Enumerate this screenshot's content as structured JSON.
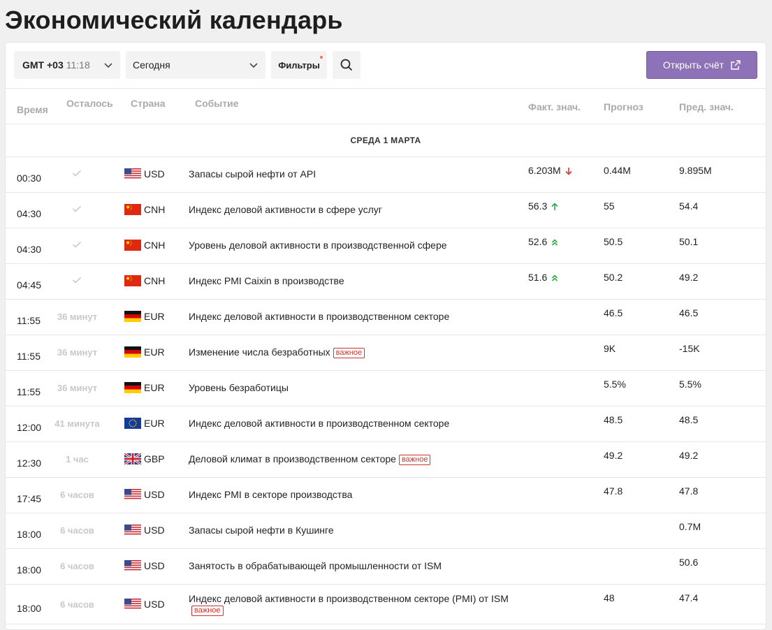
{
  "title": "Экономический календарь",
  "toolbar": {
    "tz_code": "GMT +03",
    "tz_time": "11:18",
    "date_value": "Сегодня",
    "filters_label": "Фильтры",
    "open_account_label": "Открыть счёт"
  },
  "columns": {
    "time": "Время",
    "left": "Осталось",
    "country": "Страна",
    "event": "Событие",
    "actual": "Факт. знач.",
    "forecast": "Прогноз",
    "previous": "Пред. знач."
  },
  "section_date": "СРЕДА 1 МАРТА",
  "colors": {
    "accent": "#8d72b8",
    "down": "#e0352b",
    "up": "#2eaa4a",
    "important": "#d0342c"
  },
  "rows": [
    {
      "time": "00:30",
      "left": "",
      "done": true,
      "flag": "us-flag",
      "currency": "USD",
      "event": "Запасы сырой нефти от API",
      "badge": "",
      "actual": "6.203M",
      "trend": "down",
      "forecast": "0.44M",
      "previous": "9.895M"
    },
    {
      "time": "04:30",
      "left": "",
      "done": true,
      "flag": "cn-flag",
      "currency": "CNH",
      "event": "Индекс деловой активности в сфере услуг",
      "badge": "",
      "actual": "56.3",
      "trend": "up",
      "forecast": "55",
      "previous": "54.4"
    },
    {
      "time": "04:30",
      "left": "",
      "done": true,
      "flag": "cn-flag",
      "currency": "CNH",
      "event": "Уровень деловой активности в производственной сфере",
      "badge": "",
      "actual": "52.6",
      "trend": "up2",
      "forecast": "50.5",
      "previous": "50.1"
    },
    {
      "time": "04:45",
      "left": "",
      "done": true,
      "flag": "cn-flag",
      "currency": "CNH",
      "event": "Индекс PMI Caixin в производстве",
      "badge": "",
      "actual": "51.6",
      "trend": "up2",
      "forecast": "50.2",
      "previous": "49.2"
    },
    {
      "time": "11:55",
      "left": "36 минут",
      "done": false,
      "flag": "de-flag",
      "currency": "EUR",
      "event": "Индекс деловой активности в производственном секторе",
      "badge": "",
      "actual": "",
      "trend": "",
      "forecast": "46.5",
      "previous": "46.5"
    },
    {
      "time": "11:55",
      "left": "36 минут",
      "done": false,
      "flag": "de-flag",
      "currency": "EUR",
      "event": "Изменение числа безработных",
      "badge": "важное",
      "actual": "",
      "trend": "",
      "forecast": "9K",
      "previous": "-15K"
    },
    {
      "time": "11:55",
      "left": "36 минут",
      "done": false,
      "flag": "de-flag",
      "currency": "EUR",
      "event": "Уровень безработицы",
      "badge": "",
      "actual": "",
      "trend": "",
      "forecast": "5.5%",
      "previous": "5.5%"
    },
    {
      "time": "12:00",
      "left": "41 минута",
      "done": false,
      "flag": "eu-flag",
      "currency": "EUR",
      "event": "Индекс деловой активности в производственном секторе",
      "badge": "",
      "actual": "",
      "trend": "",
      "forecast": "48.5",
      "previous": "48.5"
    },
    {
      "time": "12:30",
      "left": "1 час",
      "done": false,
      "flag": "gb-flag",
      "currency": "GBP",
      "event": "Деловой климат в производственном секторе",
      "badge": "важное",
      "actual": "",
      "trend": "",
      "forecast": "49.2",
      "previous": "49.2"
    },
    {
      "time": "17:45",
      "left": "6 часов",
      "done": false,
      "flag": "us-flag",
      "currency": "USD",
      "event": "Индекс PMI в секторе производства",
      "badge": "",
      "actual": "",
      "trend": "",
      "forecast": "47.8",
      "previous": "47.8"
    },
    {
      "time": "18:00",
      "left": "6 часов",
      "done": false,
      "flag": "us-flag",
      "currency": "USD",
      "event": "Запасы сырой нефти в Кушинге",
      "badge": "",
      "actual": "",
      "trend": "",
      "forecast": "",
      "previous": "0.7M"
    },
    {
      "time": "18:00",
      "left": "6 часов",
      "done": false,
      "flag": "us-flag",
      "currency": "USD",
      "event": "Занятость в обрабатывающей промышленности от ISM",
      "badge": "",
      "actual": "",
      "trend": "",
      "forecast": "",
      "previous": "50.6"
    },
    {
      "time": "18:00",
      "left": "6 часов",
      "done": false,
      "flag": "us-flag",
      "currency": "USD",
      "event": "Индекс деловой активности в производственном секторе (PMI) от ISM",
      "badge": "важное",
      "actual": "",
      "trend": "",
      "forecast": "48",
      "previous": "47.4"
    }
  ]
}
